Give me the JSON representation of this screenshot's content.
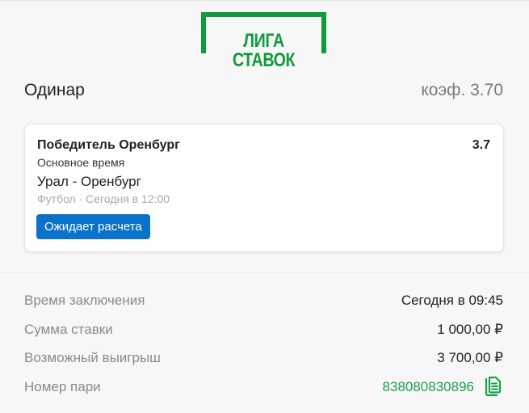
{
  "brand": {
    "logo_text": "ЛИГА СТАВОК",
    "logo_color": "#0f9a3c"
  },
  "bet": {
    "type": "Одинар",
    "coef_label": "коэф. 3.70"
  },
  "selection": {
    "outcome": "Победитель Оренбург",
    "odd": "3.7",
    "period": "Основное время",
    "match": "Урал - Оренбург",
    "meta": "Футбол · Сегодня в 12:00",
    "status": "Ожидает расчета",
    "status_color": "#0a73c9"
  },
  "details": {
    "time_label": "Время заключения",
    "time_value": "Сегодня в 09:45",
    "amount_label": "Сумма ставки",
    "amount_value": "1 000,00 ₽",
    "payout_label": "Возможный выигрыш",
    "payout_value": "3 700,00 ₽",
    "id_label": "Номер пари",
    "id_value": "838080830896",
    "id_color": "#1aa04a",
    "copy_icon": "copy-document-icon"
  }
}
